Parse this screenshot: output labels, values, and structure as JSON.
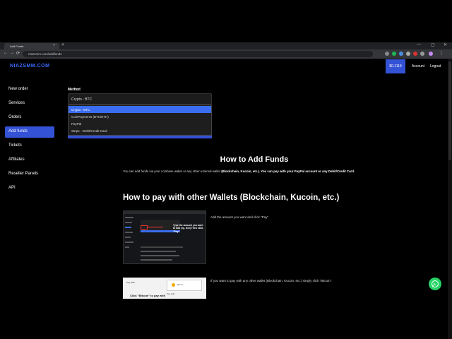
{
  "browser": {
    "tab_title": "Add Funds",
    "tab_close": "×",
    "new_tab": "+",
    "url": "niazsmm.com/addfunds",
    "back": "←",
    "forward": "→",
    "reload": "⟳",
    "minimize": "—",
    "maximize": "▢",
    "close": "✕",
    "menu": "⋮"
  },
  "header": {
    "brand": "NIAZSMM.COM",
    "balance": "$0.1119",
    "account": "Account",
    "logout": "Logout"
  },
  "sidebar": {
    "items": [
      {
        "label": "New order"
      },
      {
        "label": "Services"
      },
      {
        "label": "Orders"
      },
      {
        "label": "Add funds",
        "active": true
      },
      {
        "label": "Tickets"
      },
      {
        "label": "Affiliates"
      },
      {
        "label": "Reseller Panels"
      },
      {
        "label": "API"
      }
    ]
  },
  "method": {
    "label": "Method",
    "selected": "Crypto - BTC",
    "options": [
      {
        "label": "Crypto - BTC",
        "highlighted": true
      },
      {
        "label": "CoinPayments (BTC/ETH)"
      },
      {
        "label": "PayPal"
      },
      {
        "label": "Stripe - Debit/Credit Card"
      }
    ]
  },
  "content": {
    "how_to_title": "How to Add Funds",
    "intro_prefix": "You can add funds via your coinbase wallet or any other external wallet ",
    "intro_bold1": "(Blockchain, Kucoin, etc.). You can pay with your PayPal account or any Debit/Credit Card.",
    "wallets_title": "How to pay with other Wallets (Blockchain, Kucoin, etc.)",
    "step1": "Add the amount you want and click \"Pay\"",
    "step2": "If you want to pay with any other wallet (Blockchain, Kucoin, etc.) simply click \"Bitcoin\".",
    "thumb1_note": "Type the amount you want to add (eg. $10) Then click \"Pay\"",
    "thumb2_title": "Pay With",
    "thumb2_card": "Bitcoin",
    "thumb2_pay": "Pay with",
    "thumb2_bold": "Click \"Bitcoin\" to pay with"
  },
  "colors": {
    "accent": "#3352d6",
    "brand": "#3b6cff",
    "whatsapp": "#25d366"
  }
}
